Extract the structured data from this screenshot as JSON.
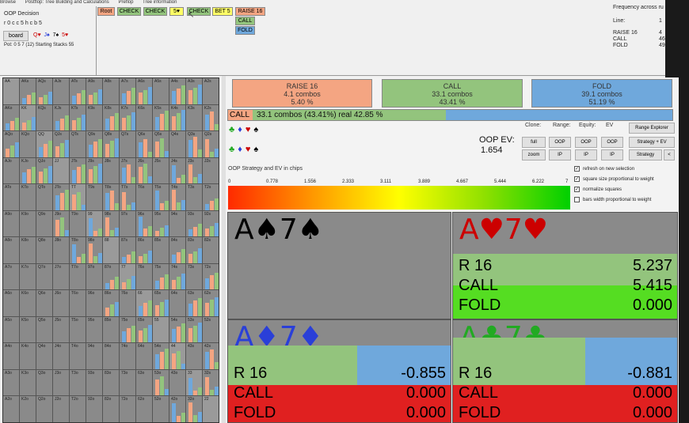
{
  "menu": {
    "items": [
      "Browse",
      "Postflop: Tree Building and Calculations",
      "Preflop",
      "Tree information"
    ]
  },
  "left_panel": {
    "title": "OOP Decision",
    "range_text": "r 0 c c 5 h c b 5",
    "board_button": "board",
    "board_cards": [
      "Q♥",
      "J♠",
      "7♠",
      "5♥"
    ],
    "pot_text": "Pot: 0 5 7 (12) Starting Stacks 55"
  },
  "tree_buttons": [
    {
      "label": "Root",
      "bg": "#f4a582"
    },
    {
      "label": "CHECK",
      "bg": "#93c47d"
    },
    {
      "label": "CHECK",
      "bg": "#93c47d"
    },
    {
      "label": "5♥",
      "bg": "#ffff66"
    },
    {
      "label": "CHECK",
      "bg": "#93c47d"
    },
    {
      "label": "BET 5",
      "bg": "#ffff66"
    },
    {
      "label": "RAISE 16",
      "bg": "#f4a582"
    }
  ],
  "tree_children": [
    "CALL",
    "FOLD"
  ],
  "right_info": {
    "title": "Frequency across ru",
    "line_label": "Line:",
    "line_value": "1",
    "rows": [
      {
        "label": "RAISE 16",
        "value": "4"
      },
      {
        "label": "CALL",
        "value": "46"
      },
      {
        "label": "FOLD",
        "value": "49"
      }
    ]
  },
  "hand_grid": {
    "rows": [
      [
        "AA",
        "AKs",
        "AQs",
        "AJs",
        "ATs",
        "A9s",
        "A8s",
        "A7s",
        "A6s",
        "A5s",
        "A4s",
        "A3s",
        "A2s"
      ],
      [
        "AKo",
        "KK",
        "KQs",
        "KJs",
        "KTs",
        "K9s",
        "K8s",
        "K7s",
        "K6s",
        "K5s",
        "K4s",
        "K3s",
        "K2s"
      ],
      [
        "AQo",
        "KQo",
        "QQ",
        "QJs",
        "QTs",
        "Q9s",
        "Q8s",
        "Q7s",
        "Q6s",
        "Q5s",
        "Q4s",
        "Q3s",
        "Q2s"
      ],
      [
        "AJo",
        "KJo",
        "QJo",
        "JJ",
        "JTs",
        "J9s",
        "J8s",
        "J7s",
        "J6s",
        "J5s",
        "J4s",
        "J3s",
        "J2s"
      ],
      [
        "ATo",
        "KTo",
        "QTo",
        "JTo",
        "TT",
        "T9s",
        "T8s",
        "T7s",
        "T6s",
        "T5s",
        "T4s",
        "T3s",
        "T2s"
      ],
      [
        "A9o",
        "K9o",
        "Q9o",
        "J9o",
        "T9o",
        "99",
        "98s",
        "97s",
        "96s",
        "95s",
        "94s",
        "93s",
        "92s"
      ],
      [
        "A8o",
        "K8o",
        "Q8o",
        "J8o",
        "T8o",
        "98o",
        "88",
        "87s",
        "86s",
        "85s",
        "84s",
        "83s",
        "82s"
      ],
      [
        "A7o",
        "K7o",
        "Q7o",
        "J7o",
        "T7o",
        "97o",
        "87o",
        "77",
        "76s",
        "75s",
        "74s",
        "73s",
        "72s"
      ],
      [
        "A6o",
        "K6o",
        "Q6o",
        "J6o",
        "T6o",
        "96o",
        "86o",
        "76o",
        "66",
        "65s",
        "64s",
        "63s",
        "62s"
      ],
      [
        "A5o",
        "K5o",
        "Q5o",
        "J5o",
        "T5o",
        "95o",
        "85o",
        "75o",
        "65o",
        "55",
        "54s",
        "53s",
        "52s"
      ],
      [
        "A4o",
        "K4o",
        "Q4o",
        "J4o",
        "T4o",
        "94o",
        "84o",
        "74o",
        "64o",
        "54o",
        "44",
        "43s",
        "42s"
      ],
      [
        "A3o",
        "K3o",
        "Q3o",
        "J3o",
        "T3o",
        "93o",
        "83o",
        "73o",
        "63o",
        "53o",
        "43o",
        "33",
        "32s"
      ],
      [
        "A2o",
        "K2o",
        "Q2o",
        "J2o",
        "T2o",
        "92o",
        "82o",
        "72o",
        "62o",
        "52o",
        "42o",
        "32o",
        "22"
      ]
    ]
  },
  "actions": [
    {
      "name": "RAISE 16",
      "combos": "4.1 combos",
      "pct": "5.40 %",
      "color": "#f4a582"
    },
    {
      "name": "CALL",
      "combos": "33.1 combos",
      "pct": "43.41 %",
      "color": "#93c47d"
    },
    {
      "name": "FOLD",
      "combos": "39.1 combos",
      "pct": "51.19 %",
      "color": "#6fa8dc"
    }
  ],
  "call_bar": {
    "tag": "CALL",
    "text": "33.1 combos (43.41%) real  42.85 %",
    "fill": 0.49
  },
  "oop_ev": {
    "label": "OOP EV:",
    "value": "1.654"
  },
  "controls": {
    "clone": "Clone:",
    "range": "Range:",
    "equity": "Equity:",
    "ev": "EV",
    "full": "full",
    "zoom": "zoom",
    "range_oop": "OOP",
    "range_ip": "IP",
    "equity_oop": "OOP",
    "equity_ip": "IP",
    "ev_oop": "OOP",
    "ev_ip": "IP",
    "range_explorer": "Range Explorer",
    "strategy_ev": "Strategy + EV",
    "strategy": "Strategy",
    "back": "<"
  },
  "scale": {
    "title": "OOP Strategy and EV in chips",
    "ticks": [
      "0",
      "0.778",
      "1.556",
      "2.333",
      "3.111",
      "3.889",
      "4.667",
      "5.444",
      "6.222",
      "7"
    ]
  },
  "options": [
    {
      "label": "refresh on new selection",
      "checked": true
    },
    {
      "label": "square size proportional to weight",
      "checked": true
    },
    {
      "label": "normalize squares",
      "checked": true
    },
    {
      "label": "bars width proportional to weight",
      "checked": false
    }
  ],
  "combos": [
    {
      "hand": "A♠7♠",
      "color": "#000000",
      "rows": []
    },
    {
      "hand": "A♥7♥",
      "color": "#cc0000",
      "rows": [
        {
          "label": "R 16",
          "value": "5.237"
        },
        {
          "label": "CALL",
          "value": "5.415"
        },
        {
          "label": "FOLD",
          "value": "0.000"
        }
      ]
    },
    {
      "hand": "A♦7♦",
      "color": "#2a3fd8",
      "rows": [
        {
          "label": "R 16",
          "value": "-0.855"
        },
        {
          "label": "CALL",
          "value": "0.000"
        },
        {
          "label": "FOLD",
          "value": "0.000"
        }
      ]
    },
    {
      "hand": "A♣7♣",
      "color": "#22aa22",
      "rows": [
        {
          "label": "R 16",
          "value": "-0.881"
        },
        {
          "label": "CALL",
          "value": "0.000"
        },
        {
          "label": "FOLD",
          "value": "0.000"
        }
      ]
    }
  ]
}
